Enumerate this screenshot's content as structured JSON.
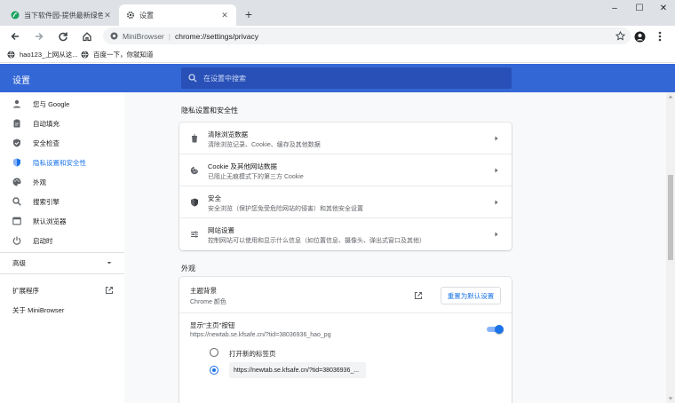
{
  "tabs": [
    {
      "title": "当下软件园-提供最新绿色软件_纯",
      "icon": "site-favicon-icon"
    },
    {
      "title": "设置",
      "icon": "gear-icon"
    }
  ],
  "toolbar": {
    "app_name": "MiniBrowser",
    "url": "chrome://settings/privacy"
  },
  "bookmarks": [
    {
      "label": "hao123_上网从这..."
    },
    {
      "label": "百度一下，你就知道"
    }
  ],
  "header": {
    "title": "设置",
    "search_placeholder": "在设置中搜索"
  },
  "sidebar": {
    "items": [
      {
        "label": "您与 Google",
        "icon": "person-icon"
      },
      {
        "label": "自动填充",
        "icon": "clipboard-icon"
      },
      {
        "label": "安全检查",
        "icon": "shield-check-icon"
      },
      {
        "label": "隐私设置和安全性",
        "icon": "shield-icon",
        "active": true
      },
      {
        "label": "外观",
        "icon": "palette-icon"
      },
      {
        "label": "搜索引擎",
        "icon": "search-icon"
      },
      {
        "label": "默认浏览器",
        "icon": "browser-window-icon"
      },
      {
        "label": "启动时",
        "icon": "power-icon"
      }
    ],
    "advanced": "高级",
    "extensions": "扩展程序",
    "about": "关于 MiniBrowser"
  },
  "privacy": {
    "title": "隐私设置和安全性",
    "rows": [
      {
        "title": "清除浏览数据",
        "subtitle": "清除浏览记录、Cookie、缓存及其他数据",
        "icon": "trash-icon"
      },
      {
        "title": "Cookie 及其他网站数据",
        "subtitle": "已阻止无痕模式下的第三方 Cookie",
        "icon": "cookie-icon"
      },
      {
        "title": "安全",
        "subtitle": "安全浏览（保护您免受危险网站的侵害）和其他安全设置",
        "icon": "security-shield-icon"
      },
      {
        "title": "网站设置",
        "subtitle": "控制网站可以使用和显示什么信息（如位置信息、摄像头、弹出式窗口及其他）",
        "icon": "sliders-icon"
      }
    ]
  },
  "appearance": {
    "title": "外观",
    "theme_title": "主题背景",
    "theme_value": "Chrome 颜色",
    "reset_label": "重置为默认设置",
    "home_title": "显示\"主页\"按钮",
    "home_url": "https://newtab.se.kfsafe.cn/?tid=38036936_hao_pg",
    "home_toggle": true,
    "radio_newtab": "打开新的标签页",
    "custom_url": "https://newtab.se.kfsafe.cn/?tid=38036936_...",
    "selected": "custom"
  },
  "colors": {
    "accent": "#1a73e8",
    "header": "#3367d6"
  }
}
